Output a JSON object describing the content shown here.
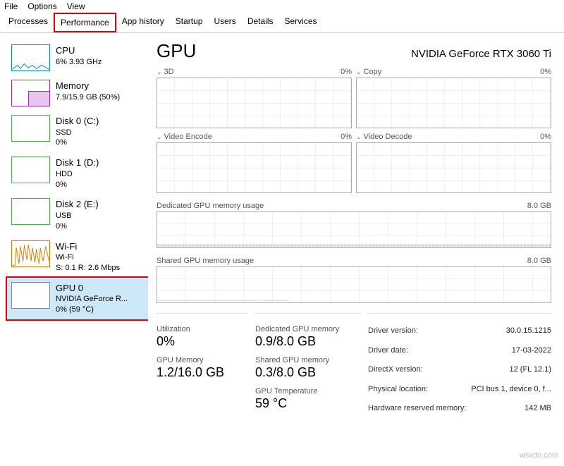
{
  "menubar": [
    "File",
    "Options",
    "View"
  ],
  "tabs": [
    "Processes",
    "Performance",
    "App history",
    "Startup",
    "Users",
    "Details",
    "Services"
  ],
  "active_tab_index": 1,
  "sidebar": [
    {
      "title": "CPU",
      "line2": "6% 3.93 GHz",
      "line3": "",
      "kind": "cpu"
    },
    {
      "title": "Memory",
      "line2": "7.9/15.9 GB (50%)",
      "line3": "",
      "kind": "mem"
    },
    {
      "title": "Disk 0 (C:)",
      "line2": "SSD",
      "line3": "0%",
      "kind": "disk"
    },
    {
      "title": "Disk 1 (D:)",
      "line2": "HDD",
      "line3": "0%",
      "kind": "disk"
    },
    {
      "title": "Disk 2 (E:)",
      "line2": "USB",
      "line3": "0%",
      "kind": "disk"
    },
    {
      "title": "Wi-Fi",
      "line2": "Wi-Fi",
      "line3": "S: 0.1 R: 2.6 Mbps",
      "kind": "wifi"
    },
    {
      "title": "GPU 0",
      "line2": "NVIDIA GeForce R...",
      "line3": "0% (59 °C)",
      "kind": "gpu",
      "selected": true
    }
  ],
  "main": {
    "title": "GPU",
    "model": "NVIDIA GeForce RTX 3060 Ti",
    "charts2": [
      {
        "name": "3D",
        "pct": "0%"
      },
      {
        "name": "Copy",
        "pct": "0%"
      },
      {
        "name": "Video Encode",
        "pct": "0%"
      },
      {
        "name": "Video Decode",
        "pct": "0%"
      }
    ],
    "mem_dedicated": {
      "label": "Dedicated GPU memory usage",
      "max": "8.0 GB"
    },
    "mem_shared": {
      "label": "Shared GPU memory usage",
      "max": "8.0 GB"
    },
    "stats_a": [
      {
        "lbl": "Utilization",
        "val": "0%"
      },
      {
        "lbl": "GPU Memory",
        "val": "1.2/16.0 GB"
      }
    ],
    "stats_b": [
      {
        "lbl": "Dedicated GPU memory",
        "val": "0.9/8.0 GB"
      },
      {
        "lbl": "Shared GPU memory",
        "val": "0.3/8.0 GB"
      },
      {
        "lbl": "GPU Temperature",
        "val": "59 °C"
      }
    ],
    "stats_c": [
      {
        "k": "Driver version:",
        "v": "30.0.15.1215"
      },
      {
        "k": "Driver date:",
        "v": "17-03-2022"
      },
      {
        "k": "DirectX version:",
        "v": "12 (FL 12.1)"
      },
      {
        "k": "Physical location:",
        "v": "PCI bus 1, device 0, f..."
      },
      {
        "k": "Hardware reserved memory:",
        "v": "142 MB"
      }
    ]
  },
  "watermark": "wsxdn.com"
}
